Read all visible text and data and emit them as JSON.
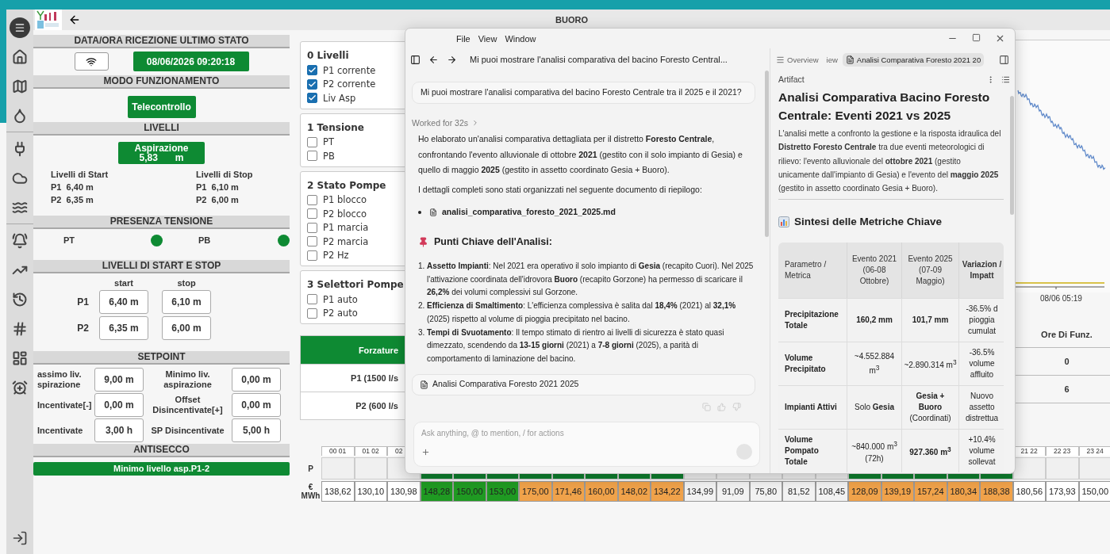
{
  "app": {
    "title": "BUORO"
  },
  "last_state": {
    "heading": "DATA/ORA RICEZIONE ULTIMO STATO",
    "timestamp": "08/06/2026 09:20:18"
  },
  "mode": {
    "heading": "MODO FUNZIONAMENTO",
    "value": "Telecontrollo"
  },
  "levels": {
    "heading": "LIVELLI",
    "gauge_label": "Aspirazione",
    "gauge_value": "5,83",
    "gauge_unit": "m",
    "start_title": "Livelli di Start",
    "stop_title": "Livelli di Stop",
    "start": [
      {
        "pump": "P1",
        "value": "6,40 m"
      },
      {
        "pump": "P2",
        "value": "6,35 m"
      }
    ],
    "stop": [
      {
        "pump": "P1",
        "value": "6,10 m"
      },
      {
        "pump": "P2",
        "value": "6,00 m"
      }
    ]
  },
  "power": {
    "heading": "PRESENZA TENSIONE",
    "items": [
      {
        "label": "PT",
        "on": true
      },
      {
        "label": "PB",
        "on": true
      }
    ]
  },
  "start_stop": {
    "heading": "LIVELLI DI START E STOP",
    "start_label": "start",
    "stop_label": "stop",
    "rows": [
      {
        "pump": "P1",
        "start": "6,40 m",
        "stop": "6,10 m"
      },
      {
        "pump": "P2",
        "start": "6,35 m",
        "stop": "6,00 m"
      }
    ]
  },
  "setpoint": {
    "heading": "SETPOINT",
    "rows": [
      {
        "left_label": "assimo liv. spirazione",
        "left_value": "9,00 m",
        "right_label": "Minimo liv. aspirazione",
        "right_value": "0,00 m"
      },
      {
        "left_label": "Incentivate[-]",
        "left_value": "0,00 m",
        "right_label": "Offset Disincentivate[+]",
        "right_value": "0,00 m"
      },
      {
        "left_label": "Incentivate",
        "left_value": "3,00 h",
        "right_label": "SP Disincentivate",
        "right_value": "5,00 h"
      }
    ]
  },
  "antisecco": {
    "heading": "ANTISECCO",
    "value": "Minimo livello asp.P1-2"
  },
  "signal_groups": [
    {
      "title": "0 Livelli",
      "items": [
        {
          "label": "P1 corrente",
          "checked": true
        },
        {
          "label": "P2 corrente",
          "checked": true
        },
        {
          "label": "Liv Asp",
          "checked": true
        }
      ]
    },
    {
      "title": "1 Tensione",
      "items": [
        {
          "label": "PT",
          "checked": false
        },
        {
          "label": "PB",
          "checked": false
        }
      ]
    },
    {
      "title": "2 Stato Pompe",
      "items": [
        {
          "label": "P1 blocco",
          "checked": false
        },
        {
          "label": "P2 blocco",
          "checked": false
        },
        {
          "label": "P1 marcia",
          "checked": false
        },
        {
          "label": "P2 marcia",
          "checked": false
        },
        {
          "label": "P2 Hz",
          "checked": false
        }
      ]
    },
    {
      "title": "3 Selettori Pompe",
      "items": [
        {
          "label": "P1 auto",
          "checked": false
        },
        {
          "label": "P2 auto",
          "checked": false
        }
      ]
    }
  ],
  "overrides": {
    "header": "Forzature",
    "rows": [
      "P1 (1500 l/s",
      "P2 (600 l/s"
    ]
  },
  "trend": {
    "axis_label": "08/06 05:19"
  },
  "run_hours": {
    "header": "Ore Di Funz.",
    "rows": [
      "0",
      "6"
    ]
  },
  "hourly": {
    "p_label": "P",
    "price_label": "€ MWh",
    "hours": [
      {
        "label": "00 01",
        "p_on": false,
        "price": "138,62",
        "color": "#ffffff"
      },
      {
        "label": "01 02",
        "p_on": false,
        "price": "130,10",
        "color": "#ffffff"
      },
      {
        "label": "02",
        "p_on": false,
        "price": "130,98",
        "color": "#ffffff"
      },
      {
        "p_on": true,
        "price": "148,28",
        "color": "#1f9a22"
      },
      {
        "p_on": true,
        "price": "150,00",
        "color": "#1f9a22"
      },
      {
        "p_on": true,
        "price": "153,00",
        "color": "#1f9a22"
      },
      {
        "p_on": true,
        "price": "175,00",
        "color": "#f0a24a"
      },
      {
        "p_on": true,
        "price": "171,46",
        "color": "#f0a24a"
      },
      {
        "p_on": true,
        "price": "160,00",
        "color": "#f0a24a"
      },
      {
        "p_on": true,
        "price": "148,02",
        "color": "#f0a24a"
      },
      {
        "p_on": true,
        "price": "134,22",
        "color": "#f0a24a"
      },
      {
        "p_on": false,
        "price": "134,99",
        "color": "#f2f2f2"
      },
      {
        "p_on": false,
        "price": "91,09",
        "color": "#f2f2f2"
      },
      {
        "p_on": false,
        "price": "75,80",
        "color": "#f2f2f2"
      },
      {
        "p_on": false,
        "price": "81,52",
        "color": "#f2f2f2"
      },
      {
        "p_on": false,
        "price": "108,45",
        "color": "#f2f2f2"
      },
      {
        "p_on": true,
        "price": "128,09",
        "color": "#f0a24a"
      },
      {
        "p_on": true,
        "price": "139,19",
        "color": "#f0a24a"
      },
      {
        "p_on": true,
        "price": "157,24",
        "color": "#f0a24a"
      },
      {
        "p_on": true,
        "price": "180,34",
        "color": "#f0a24a"
      },
      {
        "p_on": true,
        "price": "188,38",
        "color": "#f0a24a"
      },
      {
        "label": "21 22",
        "p_on": false,
        "price": "180,56",
        "color": "#ffffff"
      },
      {
        "label": "22 23",
        "p_on": false,
        "price": "173,93",
        "color": "#ffffff"
      },
      {
        "label": "23 24",
        "p_on": false,
        "price": "150,00",
        "color": "#ffffff"
      }
    ]
  },
  "assistant_window": {
    "menus": [
      "File",
      "View",
      "Window"
    ],
    "thread_title": "Mi puoi mostrare l'analisi comparativa del bacino Foresto Central...",
    "tabs": [
      {
        "label": "Overview",
        "selected": false,
        "kind": "list"
      },
      {
        "label": "iew",
        "selected": false,
        "kind": "plain"
      },
      {
        "label": "Analisi Comparativa Foresto 2021 20",
        "selected": true,
        "kind": "doc"
      }
    ],
    "user_message": "Mi puoi mostrare l'analisi comparativa del bacino Foresto Centrale tra il 2025 e il 2021?",
    "worked": "Worked for 32s",
    "paragraphs": [
      "Ho elaborato un'analisi comparativa dettagliata per il distretto **Foresto Centrale**, confrontando l'evento alluvionale di ottobre **2021** (gestito con il solo impianto di Gesia) e quello di maggio **2025** (gestito in assetto coordinato Gesia + Buoro).",
      "I dettagli completi sono stati organizzati nel seguente documento di riepilogo:"
    ],
    "attachment": "analisi_comparativa_foresto_2021_2025.md",
    "key_points_heading": "Punti Chiave dell'Analisi:",
    "key_points": [
      {
        "number": "1.",
        "text": "**Assetto Impianti**: Nel 2021 era operativo il solo impianto di **Gesia** (recapito Cuori). Nel 2025 l'attivazione coordinata dell'idrovora **Buoro** (recapito Gorzone) ha permesso di scaricare il **26,2%** dei volumi complessivi sul Gorzone."
      },
      {
        "number": "2.",
        "text": "**Efficienza di Smaltimento**: L'efficienza complessiva è salita dal **18,4%** (2021) al **32,1%** (2025) rispetto al volume di pioggia precipitato nel bacino."
      },
      {
        "number": "3.",
        "text": "**Tempi di Svuotamento**: Il tempo stimato di rientro ai livelli di sicurezza è stato quasi dimezzato, scendendo da **13-15 giorni** (2021) a **7-8 giorni** (2025), a parità di comportamento di laminazione del bacino."
      }
    ],
    "artifact_card": "Analisi Comparativa Foresto 2021 2025",
    "input_placeholder": "Ask anything, @ to mention, / for actions",
    "artifact": {
      "label": "Artifact",
      "title": "Analisi Comparativa Bacino Foresto Centrale: Eventi 2021 vs 2025",
      "intro": "L'analisi mette a confronto la gestione e la risposta idraulica del **Distretto Foresto Centrale** tra due eventi meteorologici di rilievo: l'evento alluvionale del **ottobre 2021** (gestito unicamente dall'impianto di Gesia) e l'evento del **maggio 2025** (gestito in assetto coordinato Gesia + Buoro).",
      "metrics_heading": "Sintesi delle Metriche Chiave",
      "columns": [
        "Parametro / Metrica",
        "Evento 2021 (06-08 Ottobre)",
        "Evento 2025 (07-09 Maggio)",
        "Variazion / Impatt"
      ],
      "rows": [
        {
          "cells": [
            {
              "text": "Precipitazione Totale",
              "bold": true
            },
            {
              "text": "160,2 mm",
              "bold": true
            },
            {
              "text": "101,7 mm",
              "bold": true
            },
            {
              "text": "-36.5% d pioggia cumulat",
              "bold": false
            }
          ]
        },
        {
          "cells": [
            {
              "text": "Volume Precipitato",
              "bold": true
            },
            {
              "text": "~4.552.884 m$^{3}$",
              "bold": false
            },
            {
              "text": "~2.890.314 m$^{3}$",
              "bold": false
            },
            {
              "text": "-36.5% volume affluito",
              "bold": false
            }
          ]
        },
        {
          "cells": [
            {
              "text": "Impianti Attivi",
              "bold": true
            },
            {
              "text": "Solo **Gesia**",
              "bold": false
            },
            {
              "text": "**Gesia + Buoro** (Coordinati)",
              "bold": false
            },
            {
              "text": "Nuovo assetto distrettua",
              "bold": false
            }
          ]
        },
        {
          "cells": [
            {
              "text": "Volume Pompato Totale",
              "bold": true
            },
            {
              "text": "~840.000 m$^{3}$ (72h)",
              "bold": false
            },
            {
              "text": "927.360 m$^{3}$",
              "bold": true
            },
            {
              "text": "+10.4% volume sollevat",
              "bold": false
            }
          ]
        }
      ]
    }
  }
}
